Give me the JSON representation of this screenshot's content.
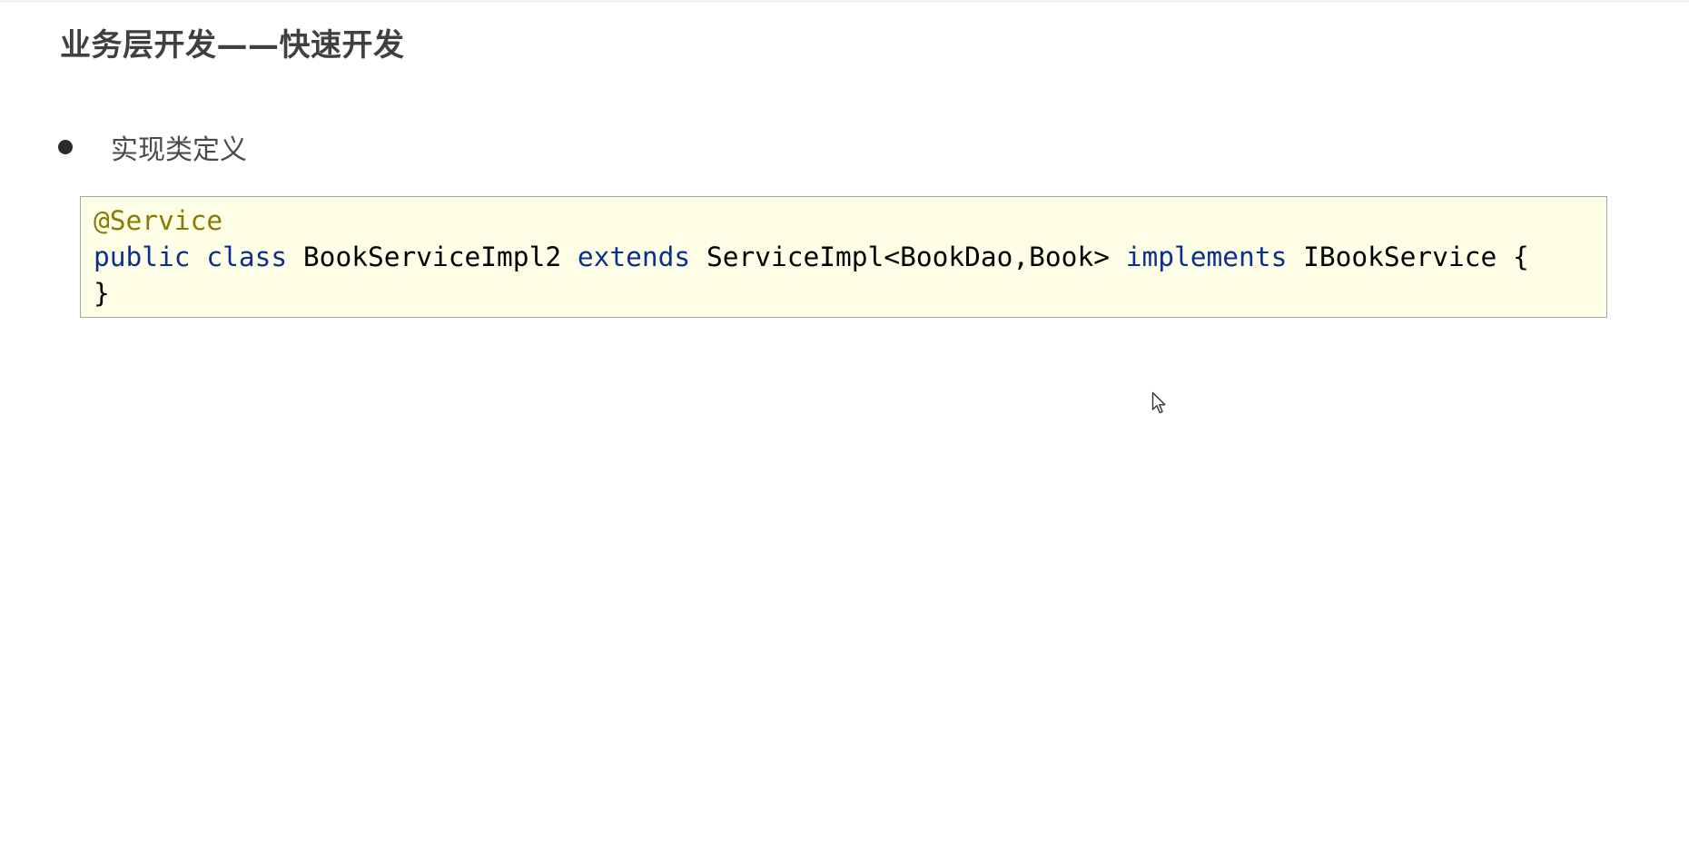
{
  "slide": {
    "title": "业务层开发——快速开发",
    "bullet": "实现类定义"
  },
  "code": {
    "language": "java",
    "annotation": "@Service",
    "line2": {
      "kw_public": "public",
      "kw_class": "class",
      "class_name": "BookServiceImpl2",
      "kw_extends": "extends",
      "super_type": "ServiceImpl<BookDao,Book>",
      "kw_implements": "implements",
      "interface": "IBookService",
      "open_brace": "{"
    },
    "close_brace": "}"
  },
  "colors": {
    "title": "#404040",
    "code_background": "#fefee6",
    "code_border": "#a8a8a0",
    "annotation": "#8c7a00",
    "keyword": "#0b2f8f"
  },
  "icons": {
    "bullet": "bullet-dot-icon",
    "cursor": "mouse-pointer-icon"
  }
}
